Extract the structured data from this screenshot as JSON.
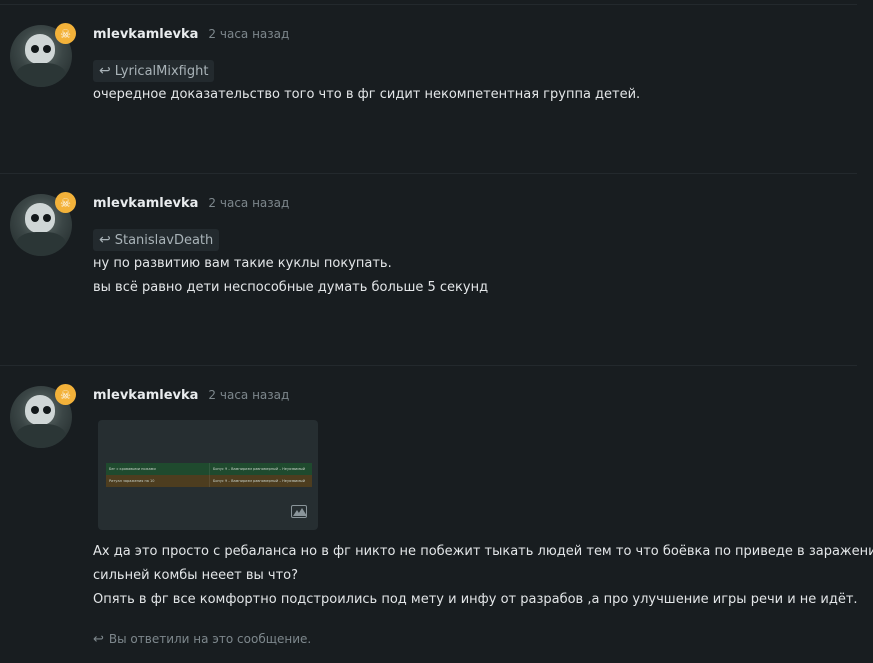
{
  "comments": [
    {
      "author": "mlevkamlevka",
      "time": "2 часа назад",
      "reply_to": "LyricalMixfight",
      "badge_icon": "skull-icon",
      "lines": [
        "очередное доказательство того что в фг сидит некомпетентная группа детей."
      ]
    },
    {
      "author": "mlevkamlevka",
      "time": "2 часа назад",
      "reply_to": "StanislavDeath",
      "badge_icon": "skull-icon",
      "lines": [
        "ну по развитию вам такие куклы покупать.",
        "вы всё равно дети неспособные думать больше 5 секунд"
      ]
    },
    {
      "author": "mlevkamlevka",
      "time": "2 часа назад",
      "badge_icon": "skull-icon",
      "attachment": {
        "rows": [
          [
            "Бег с кровавыми ножами",
            "Бонус 9 – Вампиризм равномерный – Неуязвимый"
          ],
          [
            "Ритуал заражения на 10",
            "Бонус 9 – Вампиризм равномерный – Неуязвимый"
          ]
        ],
        "icon": "image-icon"
      },
      "lines": [
        "Ах да это просто с ребаланса но в фг никто не побежит тыкать людей тем то что боёвка по приведе в заражениях",
        "сильней комбы нееет вы что?",
        "Опять в фг все комфортно подстроились под мету и инфу от разрабов ,а про улучшение игры речи и не идёт."
      ]
    }
  ],
  "replied_notice": "Вы ответили на это сообщение.",
  "colors": {
    "background": "#181d20",
    "badge": "#f3b23a",
    "muted": "#7d878c",
    "text": "#e3e6e8"
  }
}
